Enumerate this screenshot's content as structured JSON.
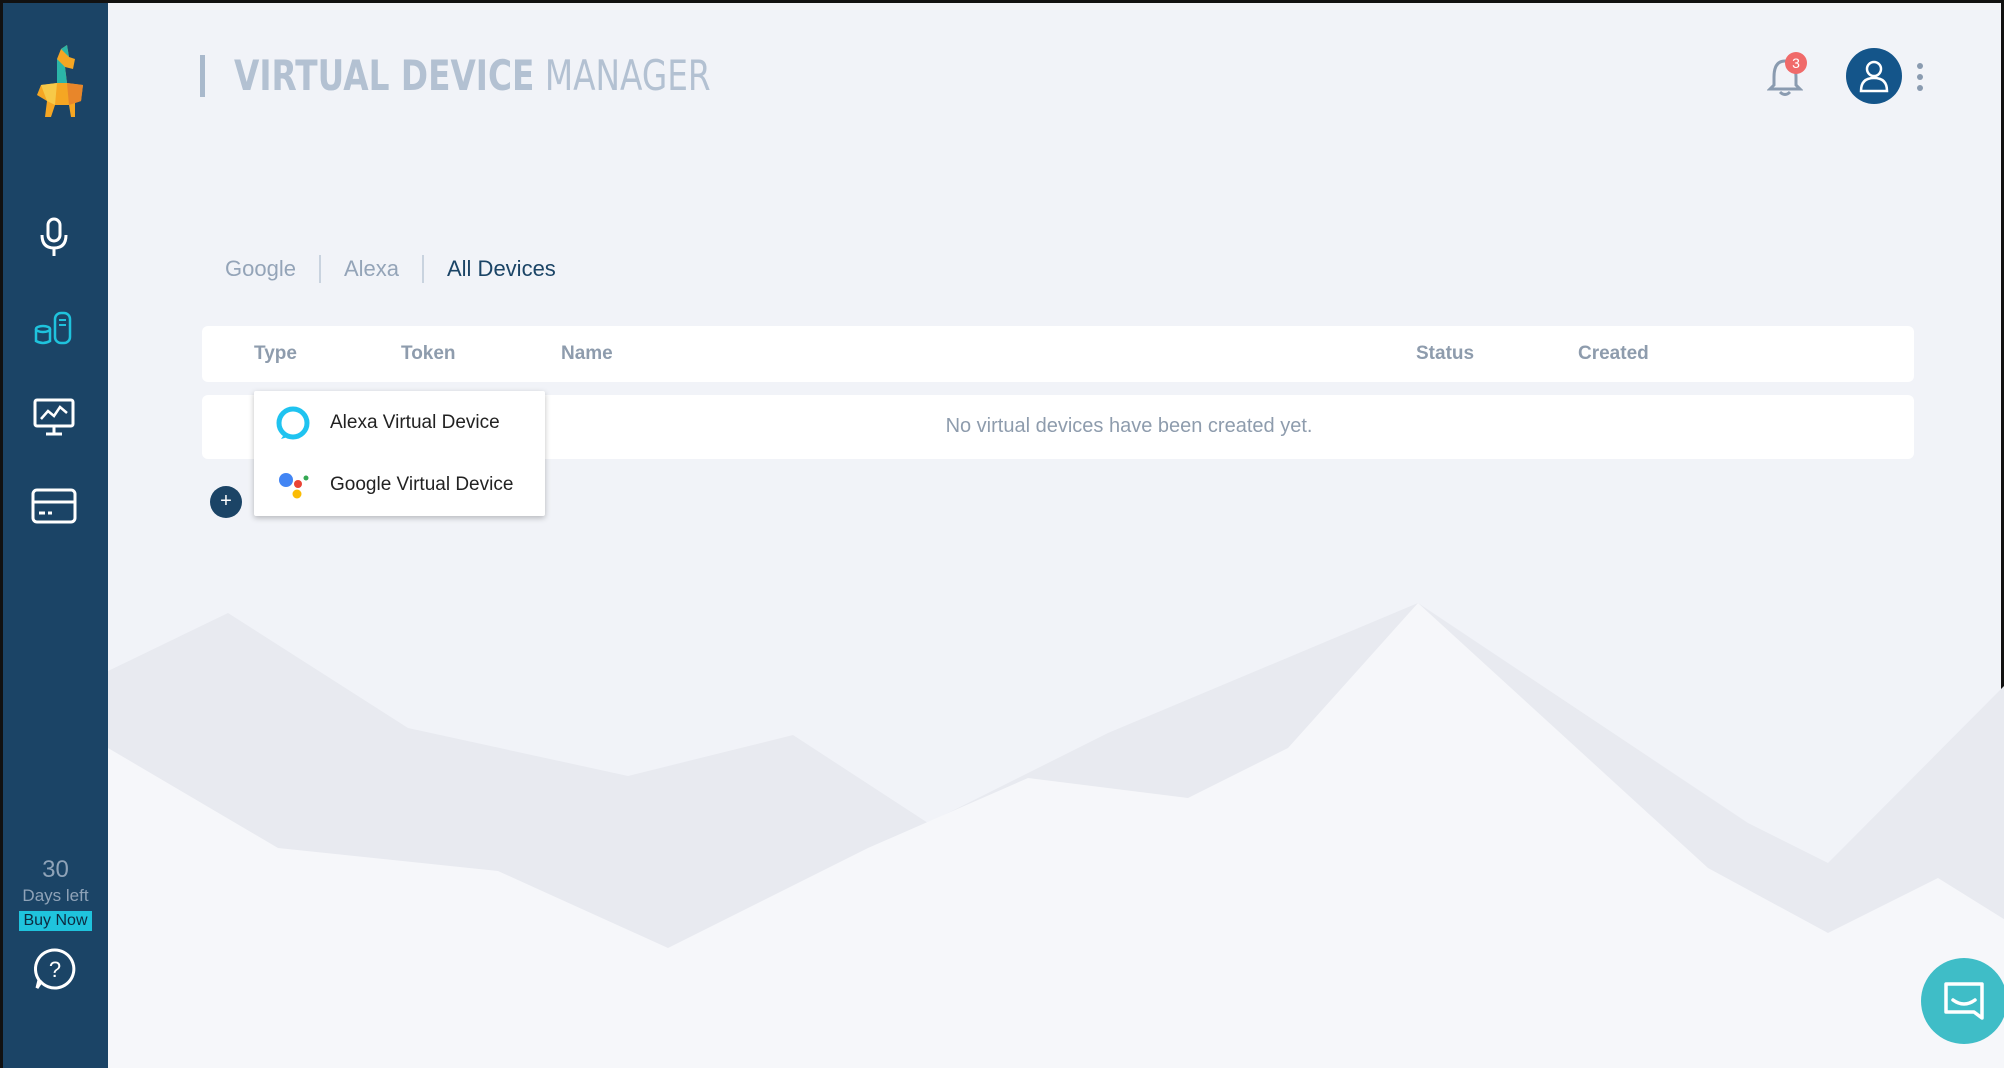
{
  "header": {
    "title_bold": "VIRTUAL DEVICE",
    "title_light": " MANAGER",
    "notification_count": "3"
  },
  "sidebar": {
    "items": [
      {
        "name": "microphone-icon"
      },
      {
        "name": "devices-icon",
        "active": true
      },
      {
        "name": "monitor-chart-icon"
      },
      {
        "name": "credit-card-icon"
      }
    ],
    "trial_days": "30",
    "trial_label": "Days left",
    "buy_now": "Buy Now"
  },
  "tabs": [
    {
      "label": "Google"
    },
    {
      "label": "Alexa"
    },
    {
      "label": "All Devices",
      "active": true
    }
  ],
  "table": {
    "columns": [
      "Type",
      "Token",
      "Name",
      "Status",
      "Created"
    ],
    "empty_message": "No virtual devices have been created yet."
  },
  "add_button": "+",
  "dropdown": {
    "items": [
      {
        "label": "Alexa Virtual Device",
        "icon": "alexa-icon"
      },
      {
        "label": "Google Virtual Device",
        "icon": "google-assistant-icon"
      }
    ]
  },
  "colors": {
    "sidebar": "#1b4466",
    "accent": "#1fc3dd",
    "badge": "#f06a6a",
    "chat": "#3fbdc7"
  }
}
